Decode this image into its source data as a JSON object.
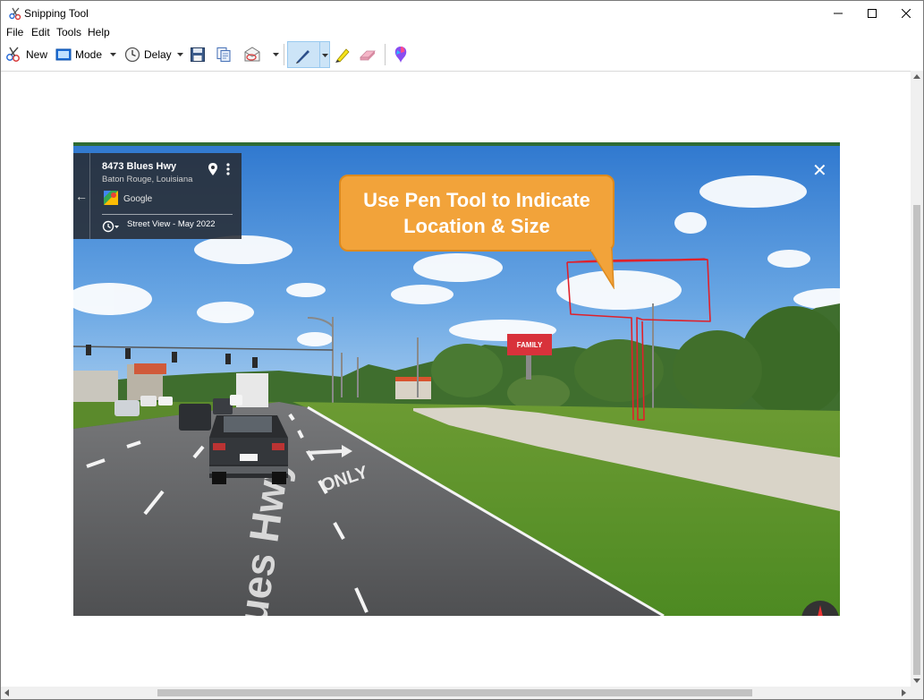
{
  "window": {
    "title": "Snipping Tool",
    "icon": "scissors-icon"
  },
  "menu": {
    "items": [
      {
        "label": "File"
      },
      {
        "label": "Edit"
      },
      {
        "label": "Tools"
      },
      {
        "label": "Help"
      }
    ]
  },
  "toolbar": {
    "new_label": "New",
    "mode_label": "Mode",
    "delay_label": "Delay",
    "icons": [
      "new-snip-icon",
      "mode-icon",
      "delay-clock-icon",
      "save-icon",
      "copy-icon",
      "send-email-icon",
      "pen-icon",
      "highlighter-icon",
      "eraser-icon",
      "paint3d-icon"
    ],
    "active_tool": "pen"
  },
  "streetview": {
    "address": "8473 Blues Hwy",
    "city": "Baton Rouge, Louisiana",
    "provider": "Google",
    "capture_date": "Street View - May 2022",
    "road_marking_1": "ONLY",
    "road_marking_2": "Blues Hwy",
    "billboard_text": "FAMILY"
  },
  "callout": {
    "line1": "Use Pen Tool to Indicate",
    "line2": "Location & Size"
  },
  "colors": {
    "callout_fill": "#f2a33a",
    "pen_annotation": "#e0202a",
    "pen_active_bg": "#cce4f7"
  }
}
